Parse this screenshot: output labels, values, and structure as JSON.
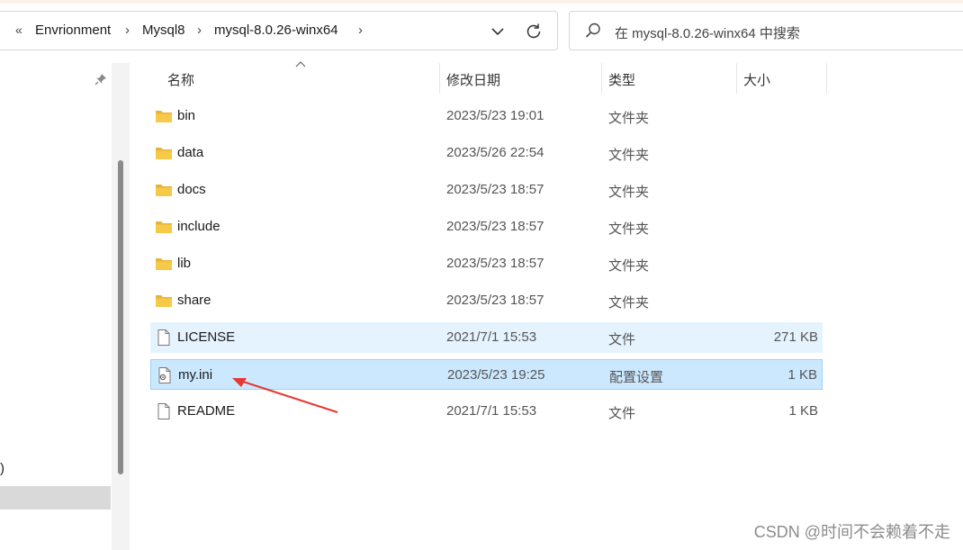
{
  "address_bar": {
    "overflow_glyph": "«",
    "breadcrumbs": [
      "Envrionment",
      "Mysql8",
      "mysql-8.0.26-winx64"
    ]
  },
  "search": {
    "placeholder": "在 mysql-8.0.26-winx64 中搜索"
  },
  "nav_pane": {
    "partial_text": ")"
  },
  "columns": {
    "name": "名称",
    "date": "修改日期",
    "type": "类型",
    "size": "大小"
  },
  "files": [
    {
      "name": "bin",
      "date": "2023/5/23 19:01",
      "type": "文件夹",
      "size": "",
      "icon": "folder-icon",
      "state": "normal"
    },
    {
      "name": "data",
      "date": "2023/5/26 22:54",
      "type": "文件夹",
      "size": "",
      "icon": "folder-icon",
      "state": "normal"
    },
    {
      "name": "docs",
      "date": "2023/5/23 18:57",
      "type": "文件夹",
      "size": "",
      "icon": "folder-icon",
      "state": "normal"
    },
    {
      "name": "include",
      "date": "2023/5/23 18:57",
      "type": "文件夹",
      "size": "",
      "icon": "folder-icon",
      "state": "normal"
    },
    {
      "name": "lib",
      "date": "2023/5/23 18:57",
      "type": "文件夹",
      "size": "",
      "icon": "folder-icon",
      "state": "normal"
    },
    {
      "name": "share",
      "date": "2023/5/23 18:57",
      "type": "文件夹",
      "size": "",
      "icon": "folder-icon",
      "state": "normal"
    },
    {
      "name": "LICENSE",
      "date": "2021/7/1 15:53",
      "type": "文件",
      "size": "271 KB",
      "icon": "file-icon",
      "state": "hover"
    },
    {
      "name": "my.ini",
      "date": "2023/5/23 19:25",
      "type": "配置设置",
      "size": "1 KB",
      "icon": "config-file-icon",
      "state": "selected"
    },
    {
      "name": "README",
      "date": "2021/7/1 15:53",
      "type": "文件",
      "size": "1 KB",
      "icon": "file-icon",
      "state": "normal"
    }
  ],
  "watermark": "CSDN @时间不会赖着不走",
  "colors": {
    "folder": "#f7c948",
    "hover_row": "#e5f3ff",
    "selected_row": "#cce8ff",
    "selected_border": "#99d1ff",
    "annotation_arrow": "#e53935"
  }
}
